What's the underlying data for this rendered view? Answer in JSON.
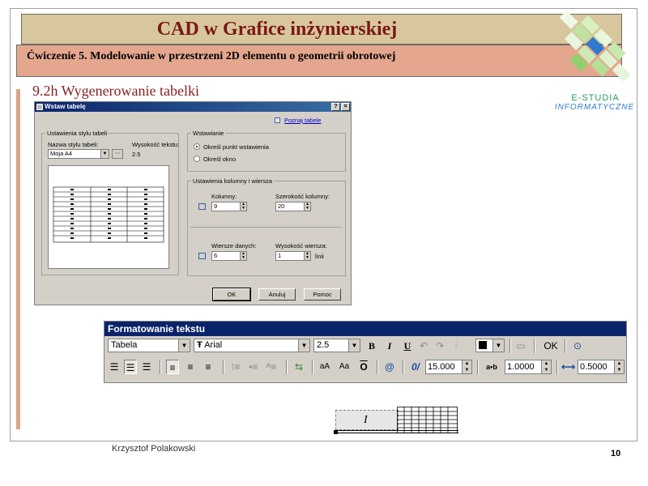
{
  "slide": {
    "title": "CAD w Grafice inżynierskiej",
    "subtitle": "Ćwiczenie 5. Modelowanie w przestrzeni 2D elementu o geometrii obrotowej",
    "section_heading": "9.2h Wygenerowanie tabelki",
    "author": "Krzysztof Polakowski",
    "page_number": "10",
    "logo_line1": "E-STUDIA",
    "logo_line2": "INFORMATYCZNE"
  },
  "dialog": {
    "title": "Wstaw tabelę",
    "help_btn": "?",
    "close_btn": "×",
    "learn_link": "Poznaj tabele",
    "style_group": "Ustawienia stylu tabeli",
    "style_name_label": "Nazwa stylu tabeli:",
    "style_name_value": "Moja A4",
    "text_height_label": "Wysokość tekstu:",
    "text_height_value": "2.5",
    "insert_group": "Wstawianie",
    "insert_point": "Określ punkt wstawienia",
    "insert_window": "Określ okno",
    "colrow_group": "Ustawienia kolumny i wiersza",
    "columns_label": "Kolumny:",
    "columns_value": "9",
    "col_width_label": "Szerokość kolumny:",
    "col_width_value": "20",
    "rows_label": "Wiersze danych:",
    "rows_value": "6",
    "row_height_label": "Wysokość wiersza:",
    "row_height_value": "1",
    "row_height_unit": "linii",
    "ok": "OK",
    "cancel": "Anuluj",
    "help": "Pomoc"
  },
  "toolbar": {
    "title": "Formatowanie tekstu",
    "style_value": "Tabela",
    "font_value": "Arial",
    "font_prefix": "Ŧ",
    "height_value": "2.5",
    "bold": "B",
    "italic": "I",
    "underline": "U",
    "ok": "OK",
    "oblique_value": "15.000",
    "tracking_value": "1.0000",
    "width_value": "0.5000",
    "tracking_label": "a•b"
  },
  "canvas": {
    "cursor_glyph": "I"
  }
}
